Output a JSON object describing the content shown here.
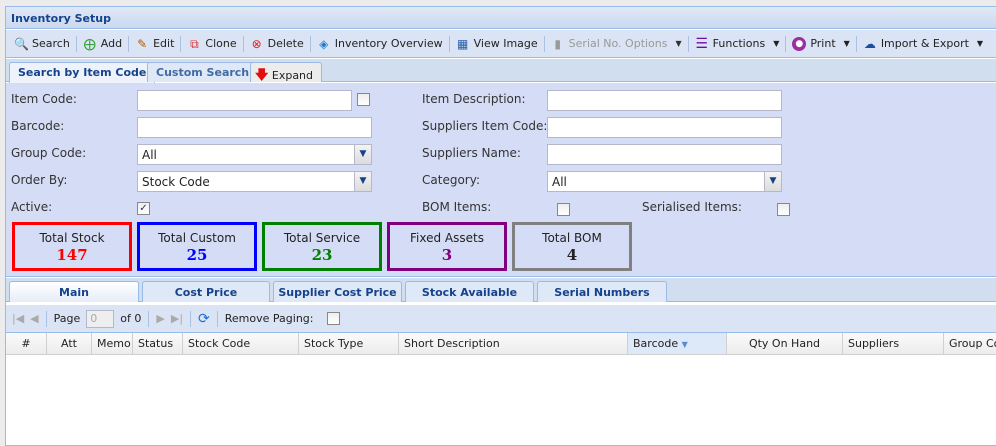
{
  "window": {
    "title": "Inventory Setup"
  },
  "toolbar": {
    "items": [
      {
        "label": "Search",
        "icon": "search-icon"
      },
      {
        "label": "Add",
        "icon": "add-document-icon"
      },
      {
        "label": "Edit",
        "icon": "edit-document-icon"
      },
      {
        "label": "Clone",
        "icon": "clone-icon"
      },
      {
        "label": "Delete",
        "icon": "delete-document-icon"
      },
      {
        "label": "Inventory Overview",
        "icon": "tag-icon"
      },
      {
        "label": "View Image",
        "icon": "image-icon"
      },
      {
        "label": "Serial No. Options",
        "icon": "barcode-icon",
        "disabled": true
      },
      {
        "label": "Functions",
        "icon": "menu-bars-icon"
      },
      {
        "label": "Print",
        "icon": "paw-icon"
      },
      {
        "label": "Import & Export",
        "icon": "cloud-transfer-icon"
      }
    ]
  },
  "search_tabs": [
    "Search by Item Code",
    "Custom Search"
  ],
  "expand_label": "Expand",
  "form": {
    "item_code": {
      "label": "Item Code:",
      "value": ""
    },
    "barcode": {
      "label": "Barcode:",
      "value": ""
    },
    "group_code": {
      "label": "Group Code:",
      "value": "All"
    },
    "order_by": {
      "label": "Order By:",
      "value": "Stock Code"
    },
    "active": {
      "label": "Active:",
      "checked": true
    },
    "item_description": {
      "label": "Item Description:",
      "value": ""
    },
    "suppliers_item_code": {
      "label": "Suppliers Item Code:",
      "value": ""
    },
    "suppliers_name": {
      "label": "Suppliers Name:",
      "value": ""
    },
    "category": {
      "label": "Category:",
      "value": "All"
    },
    "bom_items": {
      "label": "BOM Items:",
      "checked": false
    },
    "serialised_items": {
      "label": "Serialised Items:",
      "checked": false
    }
  },
  "totals": [
    {
      "label": "Total Stock",
      "value": "147",
      "color": "#ff0000"
    },
    {
      "label": "Total Custom",
      "value": "25",
      "color": "#0000ff"
    },
    {
      "label": "Total Service",
      "value": "23",
      "color": "#008000"
    },
    {
      "label": "Fixed Assets",
      "value": "3",
      "color": "#800080"
    },
    {
      "label": "Total BOM",
      "value": "4",
      "color": "#808080"
    }
  ],
  "grid_tabs": [
    "Main",
    "Cost Price",
    "Supplier Cost Price",
    "Stock Available",
    "Serial Numbers"
  ],
  "paging": {
    "page_label": "Page",
    "page_value": "0",
    "of_label": "of 0",
    "remove_paging_label": "Remove Paging:"
  },
  "columns": [
    "#",
    "Att",
    "Memo",
    "Status",
    "Stock Code",
    "Stock Type",
    "Short Description",
    "Barcode",
    "Qty On Hand",
    "Suppliers",
    "Group Co"
  ]
}
